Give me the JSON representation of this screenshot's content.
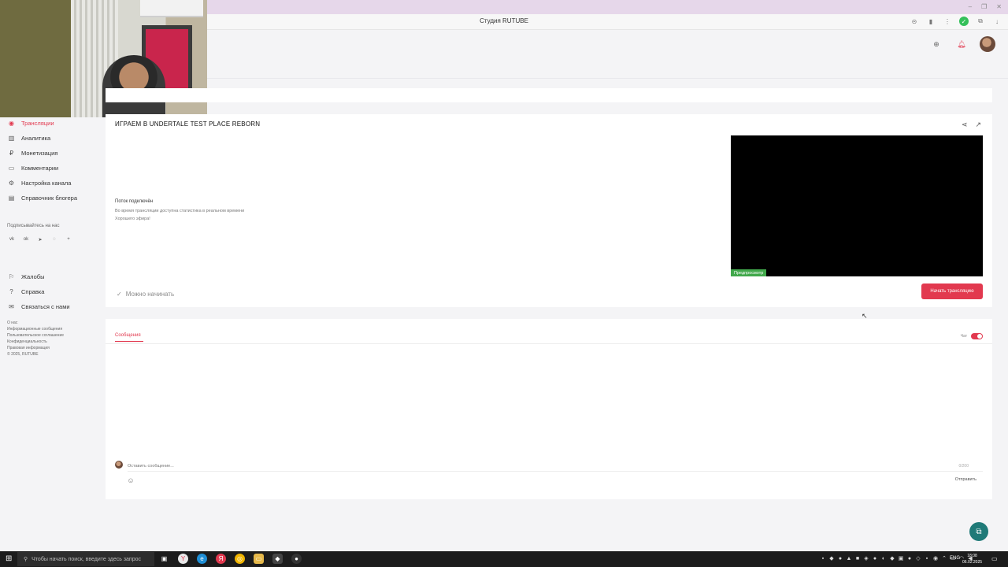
{
  "browser": {
    "title": "Студия RUTUBE",
    "window_controls": [
      "–",
      "❐",
      "✕"
    ],
    "toolbar_icons": [
      "incognito-icon",
      "bookmark-icon",
      "menu-dots-icon",
      "shield-check-icon",
      "extensions-icon",
      "download-icon"
    ]
  },
  "sidebar": {
    "nav": [
      {
        "label": "Трансляции",
        "icon": "broadcast-icon",
        "active": true
      },
      {
        "label": "Аналитика",
        "icon": "analytics-icon"
      },
      {
        "label": "Монетизация",
        "icon": "money-icon"
      },
      {
        "label": "Комментарии",
        "icon": "comments-icon"
      },
      {
        "label": "Настройка канала",
        "icon": "settings-icon"
      },
      {
        "label": "Справочник блогера",
        "icon": "book-icon"
      }
    ],
    "subscribe_label": "Подписывайтесь на нас",
    "socials": [
      "vk",
      "ok",
      "telegram",
      "viber",
      "more"
    ],
    "secondary": [
      {
        "label": "Жалобы",
        "icon": "flag-icon"
      },
      {
        "label": "Справка",
        "icon": "help-icon"
      },
      {
        "label": "Связаться с нами",
        "icon": "mail-icon"
      }
    ],
    "footer": [
      "О нас",
      "Информационные сообщения",
      "Пользовательское соглашение",
      "Конфиденциальность",
      "Правовая информация",
      "© 2025, RUTUBE"
    ]
  },
  "stream": {
    "title": "ИГРАЕМ В UNDERTALE TEST PLACE REBORN",
    "info_heading": "Поток подключён",
    "info_line1": "Во время трансляции доступна статистика в реальном времени",
    "info_line2": "Хорошего эфира!",
    "ready_label": "Можно начинать",
    "preview_badge": "Предпросмотр",
    "start_button": "Начать трансляцию"
  },
  "chat": {
    "tab": "Сообщения",
    "toggle_label": "Чат",
    "toggle_on": true,
    "input_placeholder": "Оставить сообщение...",
    "counter": "0/200",
    "send": "Отправить"
  },
  "taskbar": {
    "search_placeholder": "Чтобы начать поиск, введите здесь запрос",
    "apps": [
      "task-view-icon",
      "yandex-icon",
      "edge-icon",
      "yandex-browser-icon",
      "chrome-icon",
      "explorer-icon",
      "app-icon",
      "obs-icon"
    ],
    "lang": "ENG",
    "time": "18:08",
    "date": "06.02.2025"
  },
  "colors": {
    "accent": "#e2394f",
    "preview_badge": "#41a84b",
    "support_button": "#1f7a78"
  }
}
